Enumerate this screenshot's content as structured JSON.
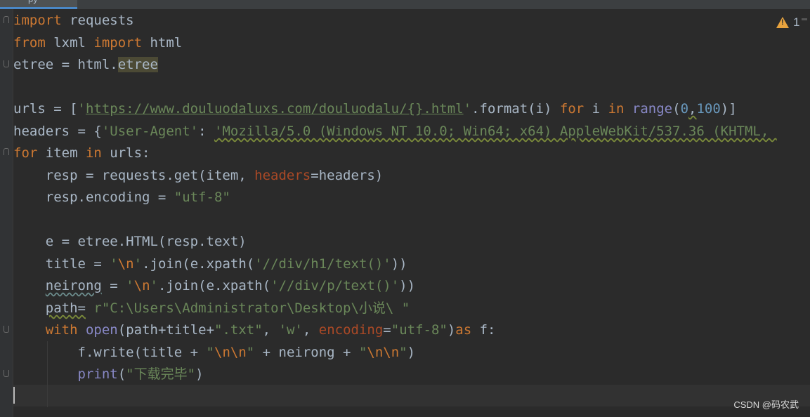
{
  "tab": {
    "label": "py"
  },
  "editor": {
    "warnings": {
      "count": "1",
      "icon": "warning-triangle-icon",
      "color": "#e8a33e"
    },
    "code": {
      "l1": {
        "kw": "import",
        "rest": " requests"
      },
      "l2": {
        "kw1": "from",
        "mid": " lxml ",
        "kw2": "import",
        "rest": " html"
      },
      "l3": {
        "pre": "etree = html.",
        "hl": "etree"
      },
      "l5": {
        "pre": "urls = [",
        "q1": "'",
        "url": "https://www.douluodaluxs.com/douluodalu/{}.html",
        "q2": "'",
        "mid": ".format(i) ",
        "for": "for",
        "i": " i ",
        "in": "in",
        "sp": " ",
        "range": "range",
        "open": "(",
        "n0": "0",
        "comma": ",",
        "n100": "100",
        "close": ")]"
      },
      "l6": {
        "pre": "headers = {",
        "key": "'User-Agent'",
        "colon": ": ",
        "val": "'Mozilla/5.0 (Windows NT 10.0; Win64; x64) AppleWebKit/537.36 (KHTML, "
      },
      "l7": {
        "kw": "for",
        "mid": " item ",
        "in": "in",
        "rest": " urls:"
      },
      "l8": {
        "pre": "    resp = requests.get(item, ",
        "param": "headers",
        "rest": "=headers)"
      },
      "l9": {
        "pre": "    resp.encoding = ",
        "str": "\"utf-8\""
      },
      "l11": {
        "text": "    e = etree.HTML(resp.text)"
      },
      "l12": {
        "pre": "    title = ",
        "q1": "'",
        "esc": "\\n",
        "q2": "'",
        "mid": ".join(e.xpath(",
        "str": "'//div/h1/text()'",
        "rest": "))"
      },
      "l13": {
        "ind": "    ",
        "var": "neirong",
        "pre": " = ",
        "q1": "'",
        "esc": "\\n",
        "q2": "'",
        "mid": ".join(e.xpath(",
        "str": "'//div/p/text()'",
        "rest": "))"
      },
      "l14": {
        "ind": "    ",
        "var": "path=",
        "sp": " ",
        "str": "r\"C:\\Users\\Administrator\\Desktop\\小说\\ \""
      },
      "l15": {
        "ind": "    ",
        "with": "with",
        "sp": " ",
        "open": "open",
        "a": "(path+title+",
        "s1": "\".txt\"",
        "c1": ", ",
        "s2": "'w'",
        "c2": ", ",
        "param": "encoding",
        "eq": "=",
        "s3": "\"utf-8\"",
        "b": ")",
        "as": "as",
        "rest": " f:"
      },
      "l16": {
        "pre": "        f.write(title + ",
        "q1": "\"",
        "e1": "\\n\\n",
        "q2": "\"",
        "mid": " + neirong + ",
        "q3": "\"",
        "e2": "\\n\\n",
        "q4": "\"",
        "rest": ")"
      },
      "l17": {
        "ind": "        ",
        "print": "print",
        "open": "(",
        "str": "\"下载完毕\"",
        "close": ")"
      }
    }
  },
  "watermark": "CSDN @码农武",
  "colors": {
    "background": "#2b2b2b",
    "keyword": "#cc7832",
    "string": "#6a8759",
    "builtin": "#8888c6",
    "number": "#6897bb",
    "param": "#aa4926",
    "text": "#a9b7c6"
  }
}
